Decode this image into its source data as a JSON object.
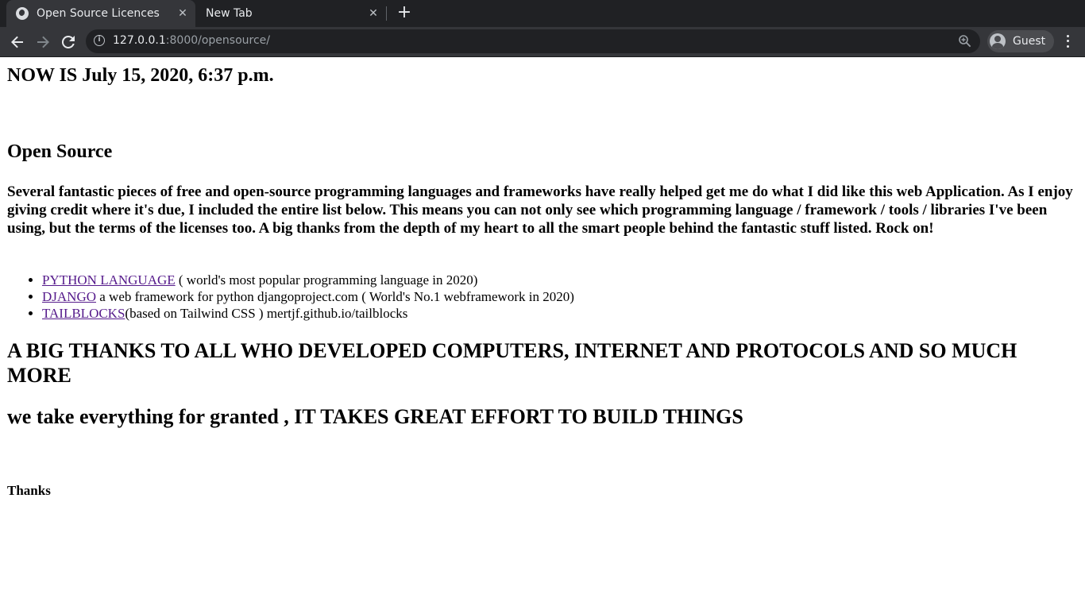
{
  "browser": {
    "tabs": [
      {
        "title": "Open Source Licences",
        "active": true
      },
      {
        "title": "New Tab",
        "active": false
      }
    ],
    "url_host": "127.0.0.1",
    "url_rest": ":8000/opensource/",
    "profile_name": "Guest",
    "colors": {
      "tabbar": "#202124",
      "toolbar": "#35363a",
      "link": "#551a8b"
    },
    "icons": [
      "globe-icon",
      "close-icon",
      "plus-icon",
      "back-arrow-icon",
      "forward-arrow-icon",
      "reload-icon",
      "info-icon",
      "zoom-icon",
      "guest-avatar-icon",
      "kebab-menu-icon"
    ]
  },
  "page": {
    "now": "NOW IS July 15, 2020, 6:37 p.m.",
    "heading": "Open Source",
    "intro": "Several fantastic pieces of free and open-source programming languages and frameworks have really helped get me do what I did like this web Application. As I enjoy giving credit where it's due, I included the entire list below. This means you can not only see which programming language / framework / tools / libraries I've been using, but the terms of the licenses too. A big thanks from the depth of my heart to all the smart people behind the fantastic stuff listed. Rock on!",
    "items": [
      {
        "link": "PYTHON LANGUAGE",
        "text": " ( world's most popular programming language in 2020)"
      },
      {
        "link": "DJANGO",
        "text": " a web framework for python djangoproject.com ( World's No.1 webframework in 2020)"
      },
      {
        "link": "TAILBLOCKS",
        "text": "(based on Tailwind CSS ) mertjf.github.io/tailblocks"
      }
    ],
    "big_thanks": "A BIG THANKS TO ALL WHO DEVELOPED COMPUTERS, INTERNET AND PROTOCOLS AND SO MUCH MORE",
    "granted": "we take everything for granted , IT TAKES GREAT EFFORT TO BUILD THINGS",
    "thanks": "Thanks"
  }
}
